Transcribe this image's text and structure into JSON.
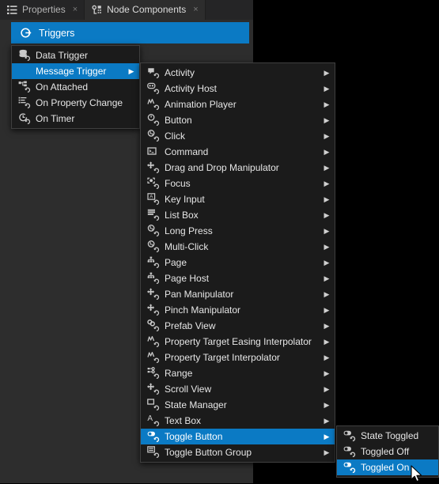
{
  "window": {
    "background_color": "#000000",
    "panel_color": "#2d2d2d"
  },
  "tabs": [
    {
      "label": "Properties",
      "icon": "list-icon",
      "close_label": "×",
      "active": false
    },
    {
      "label": "Node Components",
      "icon": "node-components-icon",
      "close_label": "×",
      "active": true
    }
  ],
  "header": {
    "title": "Triggers",
    "icon": "trigger-icon",
    "accent_color": "#0b7ac4"
  },
  "menus": {
    "triggers": {
      "name": "triggers-menu",
      "items": [
        {
          "label": "Data Trigger",
          "icon": "data-trigger-icon",
          "arrow": "",
          "selected": false
        },
        {
          "label": "Message Trigger",
          "icon": "message-trigger-icon",
          "arrow": "▶",
          "selected": true
        },
        {
          "label": "On Attached",
          "icon": "on-attached-icon",
          "arrow": "",
          "selected": false
        },
        {
          "label": "On Property Change",
          "icon": "on-property-change-icon",
          "arrow": "",
          "selected": false
        },
        {
          "label": "On Timer",
          "icon": "on-timer-icon",
          "arrow": "",
          "selected": false
        }
      ]
    },
    "message_trigger": {
      "name": "message-trigger-menu",
      "items": [
        {
          "label": "Activity",
          "icon": "activity-icon",
          "arrow": "▶",
          "selected": false
        },
        {
          "label": "Activity Host",
          "icon": "activity-host-icon",
          "arrow": "▶",
          "selected": false
        },
        {
          "label": "Animation Player",
          "icon": "animation-player-icon",
          "arrow": "▶",
          "selected": false
        },
        {
          "label": "Button",
          "icon": "button-icon",
          "arrow": "▶",
          "selected": false
        },
        {
          "label": "Click",
          "icon": "click-icon",
          "arrow": "▶",
          "selected": false
        },
        {
          "label": "Command",
          "icon": "command-icon",
          "arrow": "▶",
          "selected": false
        },
        {
          "label": "Drag and Drop Manipulator",
          "icon": "drag-drop-manipulator-icon",
          "arrow": "▶",
          "selected": false
        },
        {
          "label": "Focus",
          "icon": "focus-icon",
          "arrow": "▶",
          "selected": false
        },
        {
          "label": "Key Input",
          "icon": "key-input-icon",
          "arrow": "▶",
          "selected": false
        },
        {
          "label": "List Box",
          "icon": "list-box-icon",
          "arrow": "▶",
          "selected": false
        },
        {
          "label": "Long Press",
          "icon": "long-press-icon",
          "arrow": "▶",
          "selected": false
        },
        {
          "label": "Multi-Click",
          "icon": "multi-click-icon",
          "arrow": "▶",
          "selected": false
        },
        {
          "label": "Page",
          "icon": "page-icon",
          "arrow": "▶",
          "selected": false
        },
        {
          "label": "Page Host",
          "icon": "page-host-icon",
          "arrow": "▶",
          "selected": false
        },
        {
          "label": "Pan Manipulator",
          "icon": "pan-manipulator-icon",
          "arrow": "▶",
          "selected": false
        },
        {
          "label": "Pinch Manipulator",
          "icon": "pinch-manipulator-icon",
          "arrow": "▶",
          "selected": false
        },
        {
          "label": "Prefab View",
          "icon": "prefab-view-icon",
          "arrow": "▶",
          "selected": false
        },
        {
          "label": "Property Target Easing Interpolator",
          "icon": "property-target-easing-interpolator-icon",
          "arrow": "▶",
          "selected": false
        },
        {
          "label": "Property Target Interpolator",
          "icon": "property-target-interpolator-icon",
          "arrow": "▶",
          "selected": false
        },
        {
          "label": "Range",
          "icon": "range-icon",
          "arrow": "▶",
          "selected": false
        },
        {
          "label": "Scroll View",
          "icon": "scroll-view-icon",
          "arrow": "▶",
          "selected": false
        },
        {
          "label": "State Manager",
          "icon": "state-manager-icon",
          "arrow": "▶",
          "selected": false
        },
        {
          "label": "Text Box",
          "icon": "text-box-icon",
          "arrow": "▶",
          "selected": false
        },
        {
          "label": "Toggle Button",
          "icon": "toggle-button-icon",
          "arrow": "▶",
          "selected": true
        },
        {
          "label": "Toggle Button Group",
          "icon": "toggle-button-group-icon",
          "arrow": "▶",
          "selected": false
        }
      ]
    },
    "toggle_button": {
      "name": "toggle-button-menu",
      "items": [
        {
          "label": "State Toggled",
          "icon": "toggle-button-icon",
          "arrow": "",
          "selected": false
        },
        {
          "label": "Toggled Off",
          "icon": "toggle-button-icon",
          "arrow": "",
          "selected": false
        },
        {
          "label": "Toggled On",
          "icon": "toggle-button-icon",
          "arrow": "",
          "selected": true
        }
      ]
    }
  }
}
